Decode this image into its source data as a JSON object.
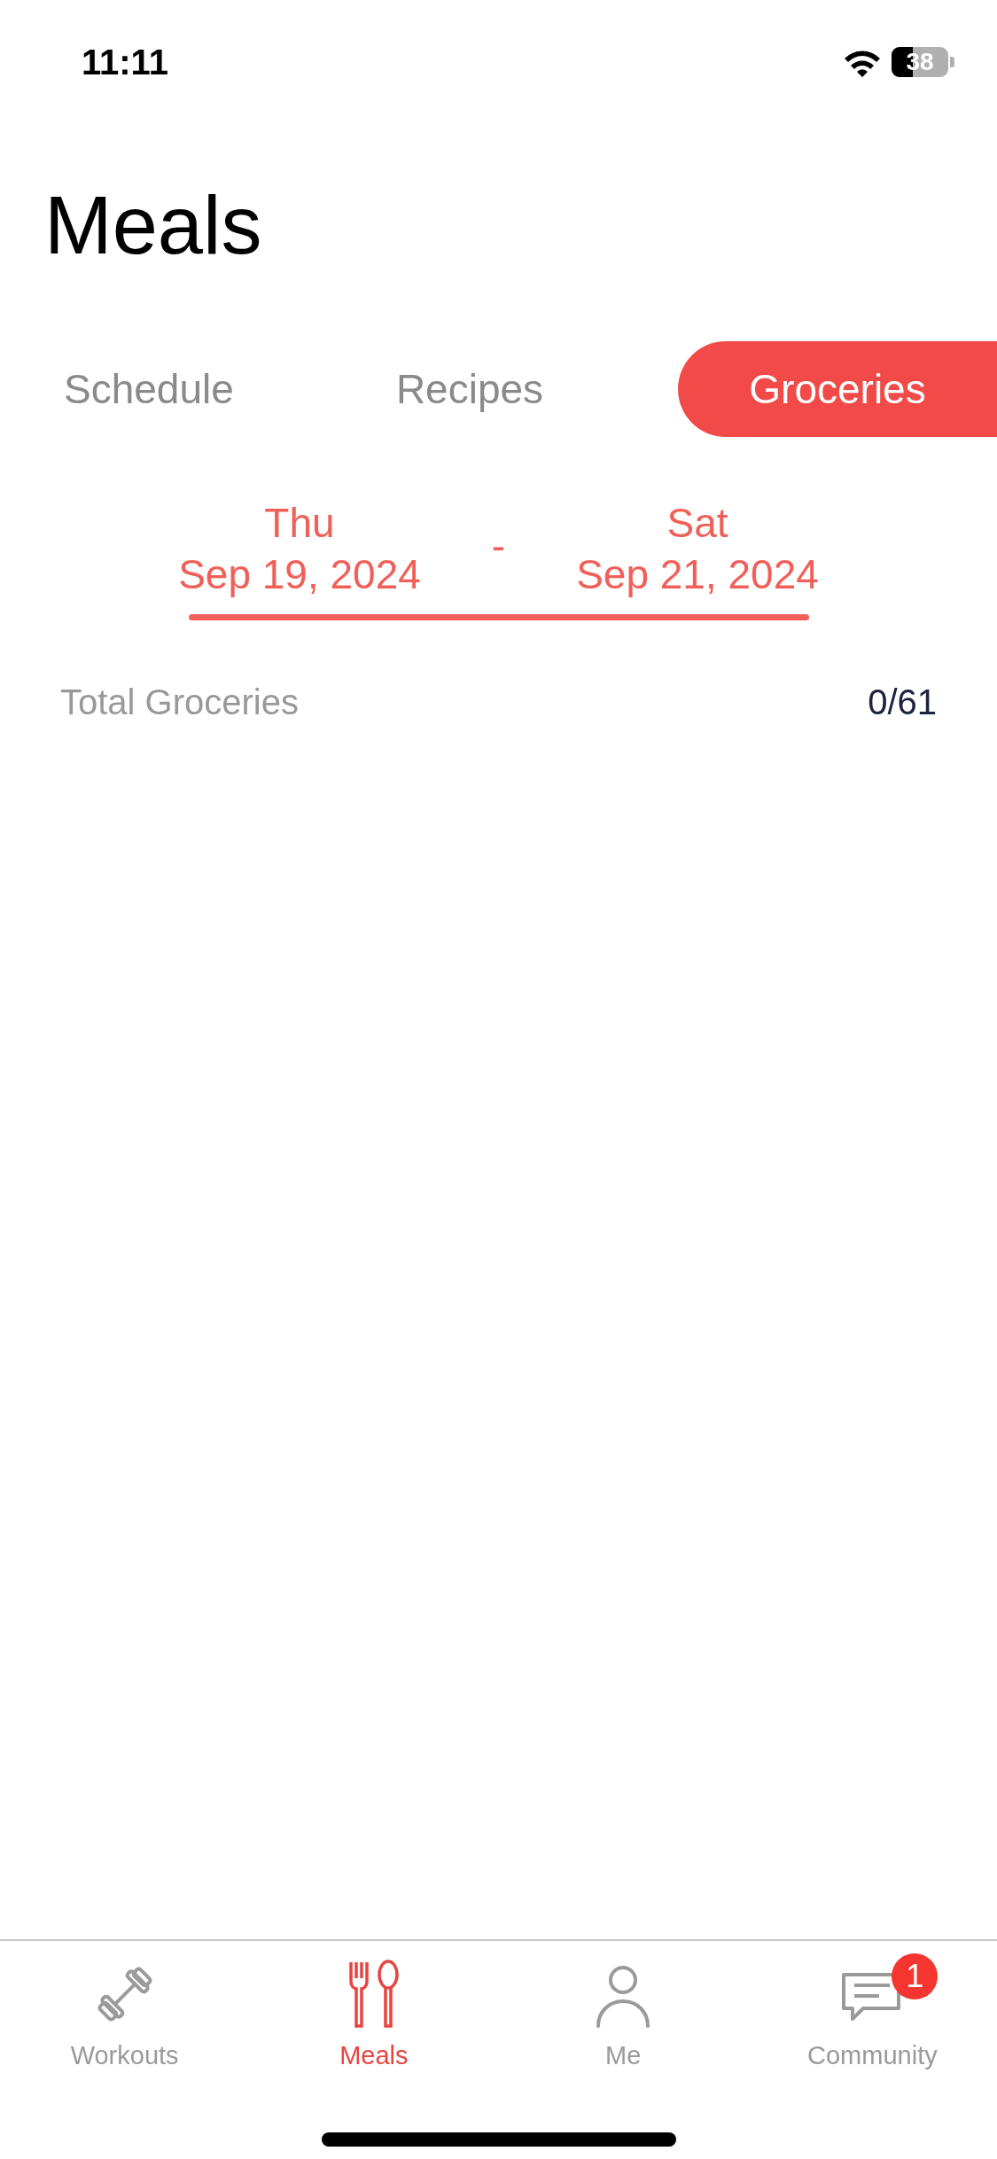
{
  "status_bar": {
    "time": "11:11",
    "battery": "38"
  },
  "title": "Meals",
  "tabs": [
    {
      "label": "Schedule",
      "selected": false
    },
    {
      "label": "Recipes",
      "selected": false
    },
    {
      "label": "Groceries",
      "selected": true
    }
  ],
  "date_range": {
    "start_day": "Thu",
    "start_date": "Sep 19, 2024",
    "separator": "-",
    "end_day": "Sat",
    "end_date": "Sep 21, 2024"
  },
  "summary": {
    "label": "Total Groceries",
    "value": "0/61"
  },
  "tab_bar": [
    {
      "kind": "dumbbell",
      "label": "Workouts",
      "selected": false
    },
    {
      "kind": "utensils",
      "label": "Meals",
      "selected": true
    },
    {
      "kind": "person",
      "label": "Me",
      "selected": false
    },
    {
      "kind": "chat",
      "label": "Community",
      "selected": false,
      "badge": "1"
    }
  ]
}
